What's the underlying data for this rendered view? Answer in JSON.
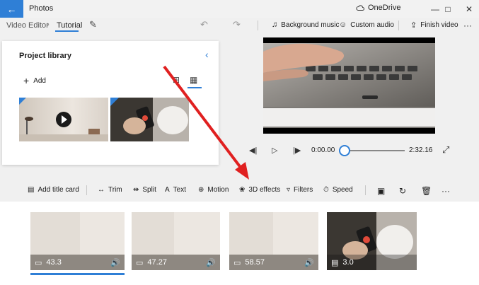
{
  "app": {
    "title": "Photos",
    "onedrive": "OneDrive"
  },
  "header": {
    "breadcrumb_root": "Video Editor",
    "breadcrumb_current": "Tutorial",
    "background_music": "Background music",
    "custom_audio": "Custom audio",
    "finish_video": "Finish video",
    "more": "···"
  },
  "library": {
    "title": "Project library",
    "add_label": "Add"
  },
  "playback": {
    "current_time": "0:00.00",
    "total_time": "2:32.16",
    "progress": 0.0
  },
  "edit_toolbar": {
    "add_title_card": "Add title card",
    "trim": "Trim",
    "split": "Split",
    "text": "Text",
    "motion": "Motion",
    "effects_3d": "3D effects",
    "filters": "Filters",
    "speed": "Speed",
    "more": "···"
  },
  "storyboard": {
    "clips": [
      {
        "duration": "43.3",
        "kind": "video",
        "selected": true
      },
      {
        "duration": "47.27",
        "kind": "video",
        "selected": false
      },
      {
        "duration": "58.57",
        "kind": "video",
        "selected": false
      },
      {
        "duration": "3.0",
        "kind": "photo",
        "selected": false
      }
    ]
  },
  "colors": {
    "accent": "#2f7fd6",
    "arrow": "#e02020"
  }
}
